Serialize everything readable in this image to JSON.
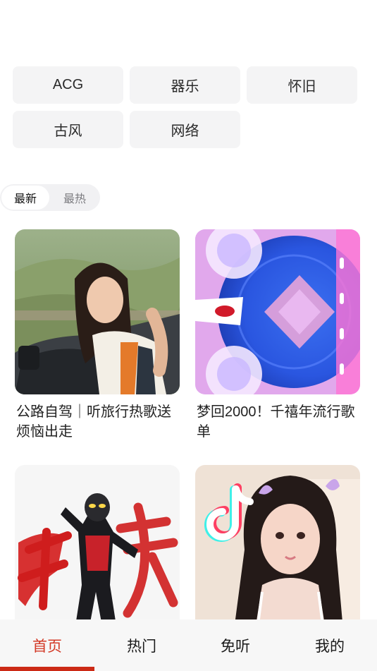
{
  "tags": [
    "ACG",
    "器乐",
    "怀旧",
    "古风",
    "网络"
  ],
  "sort": {
    "options": [
      "最新",
      "最热"
    ],
    "selected": "最新"
  },
  "playlists": [
    {
      "title": "公路自驾｜听旅行热歌送烦恼出走",
      "image": "woman-leaning-out-car-window-photo"
    },
    {
      "title": "梦回2000！千禧年流行歌单",
      "image": "pink-blue-y2k-disc-artwork"
    },
    {
      "title": "",
      "image": "red-hero-figure-calligraphy-artwork"
    },
    {
      "title": "",
      "image": "girl-with-tiktok-logo-photo"
    }
  ],
  "tabbar": {
    "items": [
      "首页",
      "热门",
      "免听",
      "我的"
    ],
    "active": "首页"
  },
  "colors": {
    "accent": "#d33a27",
    "indicator": "#cc2a16",
    "tag_bg": "#f4f4f5"
  }
}
